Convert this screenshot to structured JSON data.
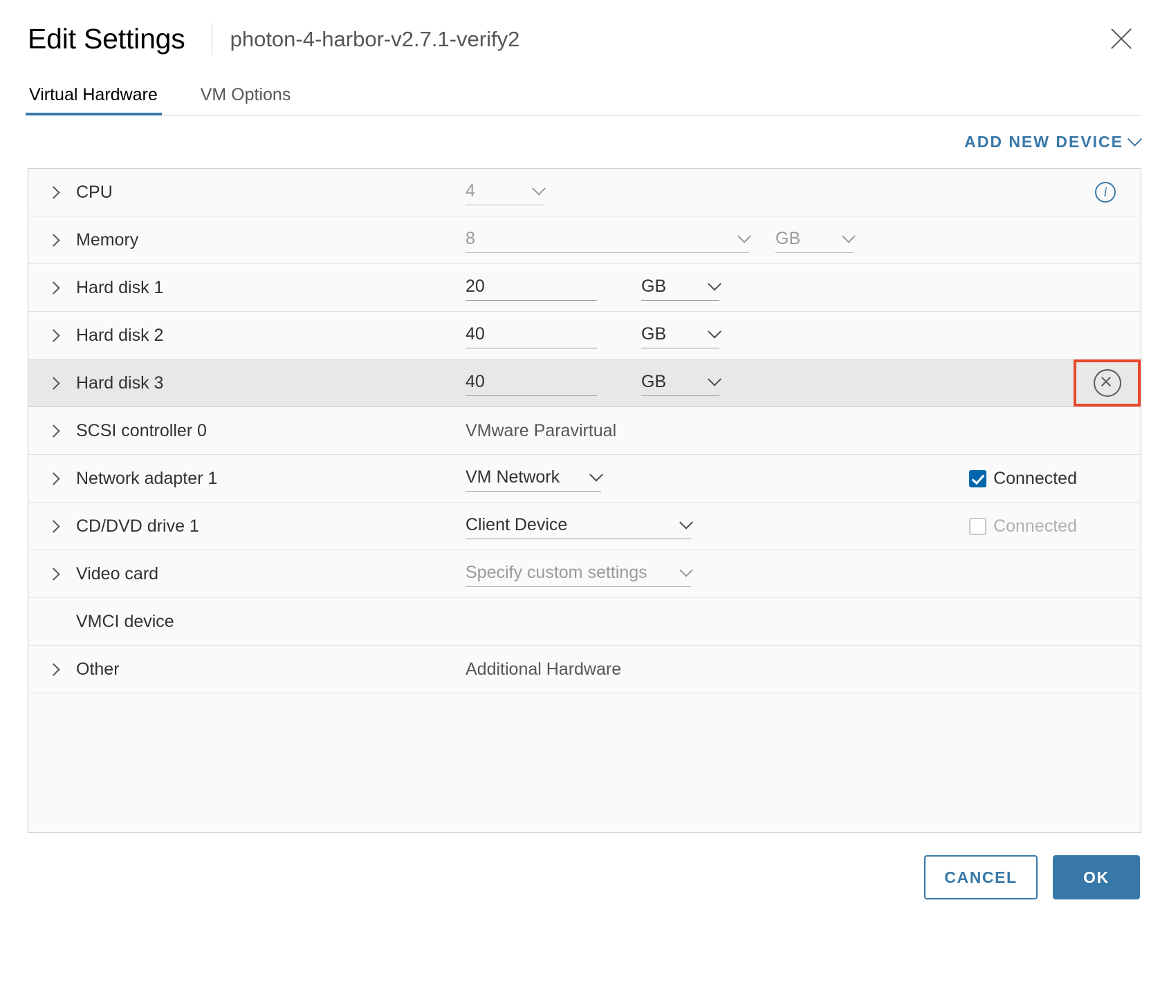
{
  "header": {
    "title": "Edit Settings",
    "vm_name": "photon-4-harbor-v2.7.1-verify2",
    "close_icon": "close-icon"
  },
  "tabs": [
    {
      "label": "Virtual Hardware",
      "active": true
    },
    {
      "label": "VM Options",
      "active": false
    }
  ],
  "toolbar": {
    "add_new_device": "ADD NEW DEVICE"
  },
  "devices": {
    "cpu": {
      "label": "CPU",
      "value": "4",
      "info_icon": "info-icon"
    },
    "memory": {
      "label": "Memory",
      "value": "8",
      "unit": "GB"
    },
    "hard_disk_1": {
      "label": "Hard disk 1",
      "value": "20",
      "unit": "GB"
    },
    "hard_disk_2": {
      "label": "Hard disk 2",
      "value": "40",
      "unit": "GB"
    },
    "hard_disk_3": {
      "label": "Hard disk 3",
      "value": "40",
      "unit": "GB",
      "remove_icon": "remove-device-icon",
      "selected": true,
      "highlighted": true
    },
    "scsi_controller_0": {
      "label": "SCSI controller 0",
      "value": "VMware Paravirtual"
    },
    "network_adapter_1": {
      "label": "Network adapter 1",
      "value": "VM Network",
      "connected_label": "Connected",
      "connected": true
    },
    "cd_dvd_drive_1": {
      "label": "CD/DVD drive 1",
      "value": "Client Device",
      "connected_label": "Connected",
      "connected": false
    },
    "video_card": {
      "label": "Video card",
      "value": "Specify custom settings"
    },
    "vmci_device": {
      "label": "VMCI device",
      "value": ""
    },
    "other": {
      "label": "Other",
      "value": "Additional Hardware"
    }
  },
  "footer": {
    "cancel_label": "CANCEL",
    "ok_label": "OK"
  },
  "colors": {
    "accent": "#3878a8",
    "checkbox": "#0065ab",
    "highlight_box": "#e8472a",
    "selected_row": "#e8e8e8"
  }
}
